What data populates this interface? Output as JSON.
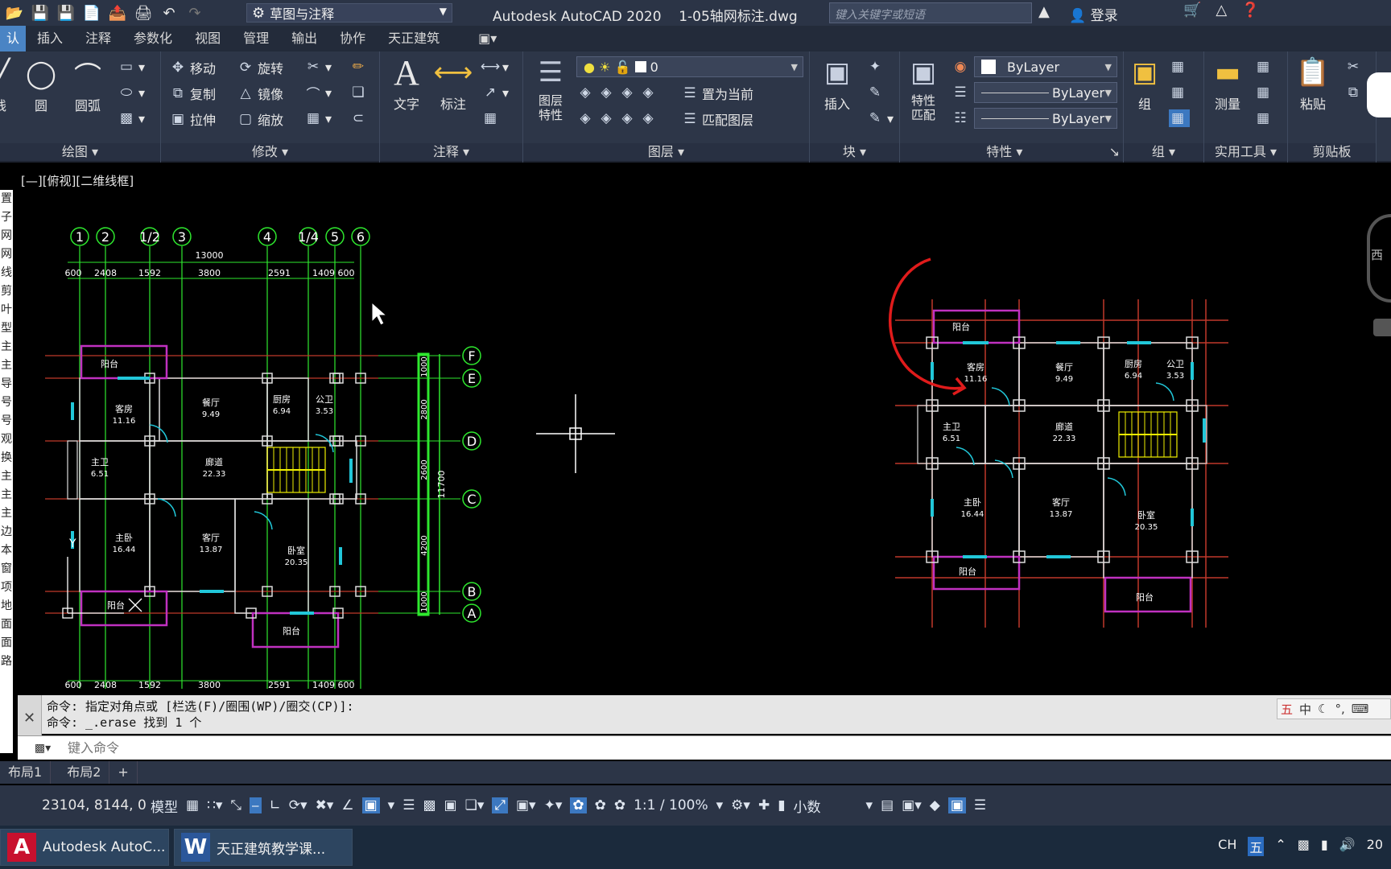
{
  "titlebar": {
    "workspace": "草图与注释",
    "app_title": "Autodesk AutoCAD 2020",
    "file_name": "1-05轴网标注.dwg",
    "search_placeholder": "键入关键字或短语",
    "login": "登录"
  },
  "ribbon_tabs": [
    "认",
    "插入",
    "注释",
    "参数化",
    "视图",
    "管理",
    "输出",
    "协作",
    "天正建筑"
  ],
  "ribbon": {
    "draw": {
      "title": "绘图",
      "line": "线",
      "circle": "圆",
      "arc": "圆弧"
    },
    "modify": {
      "title": "修改",
      "move": "移动",
      "rotate": "旋转",
      "copy": "复制",
      "mirror": "镜像",
      "stretch": "拉伸",
      "scale": "缩放"
    },
    "annotate": {
      "title": "注释",
      "text": "文字",
      "dimension": "标注"
    },
    "layers": {
      "title": "图层",
      "layer_props": "图层\n特性",
      "current_layer": "0",
      "set_current": "置为当前",
      "match_layer": "匹配图层"
    },
    "block": {
      "title": "块",
      "insert": "插入"
    },
    "properties": {
      "title": "特性",
      "match": "特性\n匹配",
      "color": "ByLayer",
      "linetype": "ByLayer",
      "lineweight": "ByLayer"
    },
    "groups": {
      "title": "组",
      "group": "组"
    },
    "utilities": {
      "title": "实用工具",
      "measure": "测量"
    },
    "clipboard": {
      "title": "剪贴板",
      "paste": "粘贴"
    }
  },
  "view_label": "[—][俯视][二维线框]",
  "left_strip": [
    "置",
    "子",
    "网",
    "网",
    "线",
    "剪",
    "叶",
    "型",
    "主",
    "主",
    "导",
    "号",
    "号",
    "观",
    "换",
    "主",
    "主",
    "主",
    "边",
    "本",
    "窗",
    "项",
    "地",
    "面",
    "面",
    "路"
  ],
  "drawing": {
    "axis_top": [
      "1",
      "2",
      "1/2",
      "3",
      "4",
      "1/4",
      "5",
      "6"
    ],
    "axis_right": [
      "F",
      "E",
      "D",
      "C",
      "B",
      "A"
    ],
    "total_width": "13000",
    "spans_top": [
      "600",
      "2408",
      "1592",
      "3800",
      "2591",
      "1409",
      "600"
    ],
    "spans_bottom": [
      "600",
      "2408",
      "1592",
      "3800",
      "2591",
      "1409",
      "600"
    ],
    "total_depth": "11700",
    "spans_right": [
      "1000",
      "2800",
      "2600",
      "4200",
      "1000"
    ],
    "rooms_left": [
      {
        "name": "阳台",
        "area": ""
      },
      {
        "name": "客房",
        "area": "11.16"
      },
      {
        "name": "餐厅",
        "area": "9.49"
      },
      {
        "name": "厨房",
        "area": "6.94"
      },
      {
        "name": "公卫",
        "area": "3.53"
      },
      {
        "name": "主卫",
        "area": "6.51"
      },
      {
        "name": "廊道",
        "area": "22.33"
      },
      {
        "name": "主卧",
        "area": "16.44"
      },
      {
        "name": "客厅",
        "area": "13.87"
      },
      {
        "name": "卧室",
        "area": "20.35"
      },
      {
        "name": "阳台",
        "area": ""
      },
      {
        "name": "阳台",
        "area": ""
      }
    ],
    "compass": "西"
  },
  "command": {
    "history1": "命令: 指定对角点或 [栏选(F)/圈围(WP)/圈交(CP)]:",
    "history2": "命令: _.erase 找到 1 个",
    "placeholder": "键入命令"
  },
  "ime": [
    "五",
    "中"
  ],
  "layout_tabs": [
    "布局1",
    "布局2",
    "+"
  ],
  "statusbar": {
    "coords": "23104, 8144, 0",
    "model": "模型",
    "scale": "1:1 / 100%",
    "units": "小数"
  },
  "taskbar": {
    "task1": "Autodesk AutoC...",
    "task2": "天正建筑教学课...",
    "tray_lang": "CH",
    "tray_ime": "五",
    "tray_year": "20"
  },
  "colors": {
    "axis_green": "#2ee82e",
    "wall_red": "#c0392b",
    "purple": "#c031c0",
    "cyan": "#21c7d9",
    "yellow": "#f0f000",
    "accent": "#3c78c0"
  }
}
